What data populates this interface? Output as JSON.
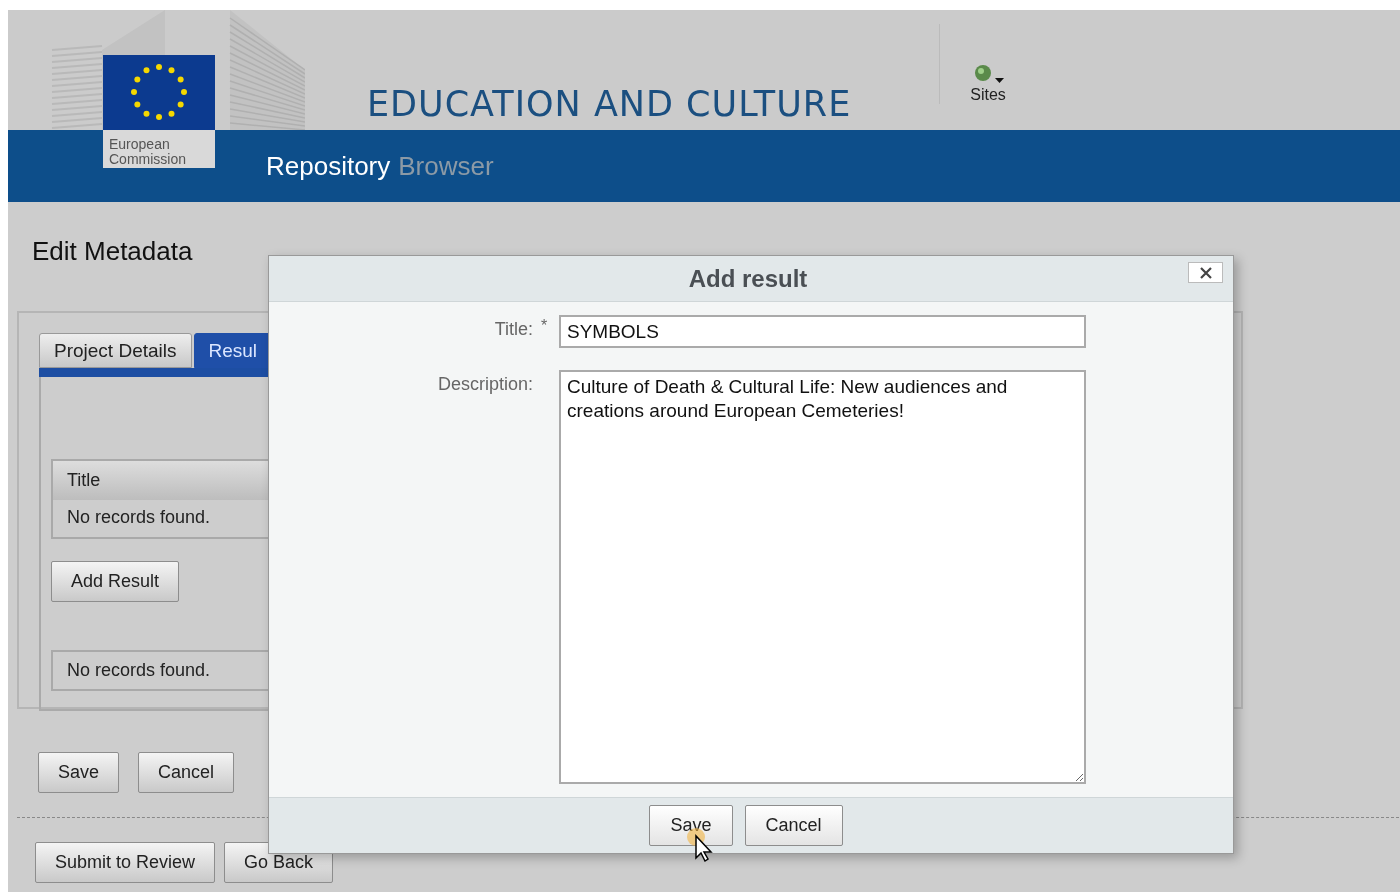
{
  "header": {
    "logo_text": "European Commission",
    "title": "EDUCATION AND CULTURE",
    "sites_label": "Sites",
    "banner_primary": "Repository",
    "banner_secondary": "Browser"
  },
  "page_title": "Edit Metadata",
  "tabs": [
    {
      "label": "Project Details",
      "selected": false
    },
    {
      "label": "Resul",
      "selected": true
    }
  ],
  "results_table": {
    "columns": [
      "Title"
    ],
    "empty_text": "No records found."
  },
  "add_button": "Add Result",
  "second_table": {
    "empty_text": "No records found."
  },
  "form_buttons": [
    "Save",
    "Cancel"
  ],
  "bottom_buttons": [
    "Submit to Review",
    "Go Back"
  ],
  "dialog": {
    "title": "Add result",
    "fields": [
      {
        "kind": "input",
        "label": "Title:",
        "required_mark": "*",
        "value": "SYMBOLS"
      },
      {
        "kind": "textarea",
        "label": "Description:",
        "value": "Culture of Death & Cultural Life: New audiences and creations around European Cemeteries!"
      }
    ],
    "buttons": [
      "Save",
      "Cancel"
    ]
  }
}
